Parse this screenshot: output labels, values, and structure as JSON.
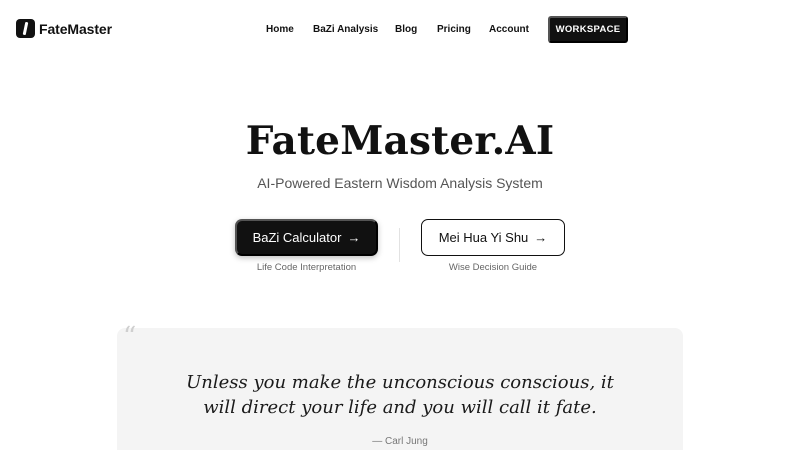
{
  "header": {
    "logo_text": "FateMaster",
    "nav": {
      "home": "Home",
      "bazi": "BaZi Analysis",
      "blog": "Blog",
      "pricing": "Pricing",
      "account": "Account"
    },
    "workspace_label": "WORKSPACE"
  },
  "hero": {
    "title": "FateMaster.AI",
    "subtitle": "AI-Powered Eastern Wisdom Analysis System"
  },
  "cta": {
    "primary_label": "BaZi Calculator",
    "primary_caption": "Life Code Interpretation",
    "secondary_label": "Mei Hua Yi Shu",
    "secondary_caption": "Wise Decision Guide",
    "arrow_glyph": "→"
  },
  "quote": {
    "mark": "“",
    "text": "Unless you make the unconscious conscious, it will direct your life and you will call it fate.",
    "author": "— Carl Jung"
  },
  "colors": {
    "primary": "#111111",
    "background": "#ffffff",
    "card": "#f4f4f4",
    "muted_text": "#555555"
  },
  "icons": {
    "logo": "fatemaster-logo-icon",
    "arrow": "arrow-right-icon",
    "quote": "quote-mark-icon"
  }
}
